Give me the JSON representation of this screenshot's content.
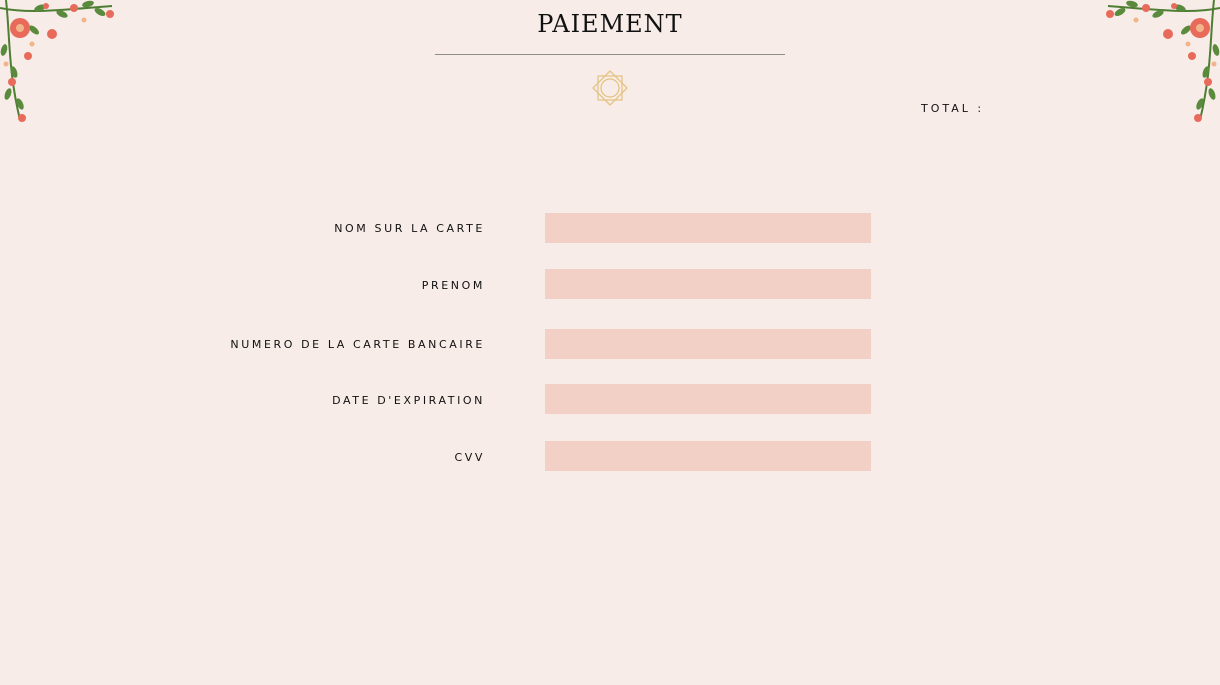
{
  "page": {
    "title": "PAIEMENT",
    "total_label": "TOTAL :"
  },
  "form": {
    "fields": [
      {
        "label": "NOM SUR LA CARTE",
        "value": ""
      },
      {
        "label": "PRENOM",
        "value": ""
      },
      {
        "label": "NUMERO DE LA CARTE BANCAIRE",
        "value": ""
      },
      {
        "label": "DATE D'EXPIRATION",
        "value": ""
      },
      {
        "label": "CVV",
        "value": ""
      }
    ]
  },
  "colors": {
    "background": "#f7ece8",
    "field_fill": "#f2d0c6",
    "emblem_gold": "#e3c27e",
    "flower_red": "#e86a5a",
    "leaf_green": "#5a8a3c"
  },
  "icons": {
    "emblem": "octagram-ornament-icon",
    "corner_decoration": "floral-corner-icon"
  }
}
